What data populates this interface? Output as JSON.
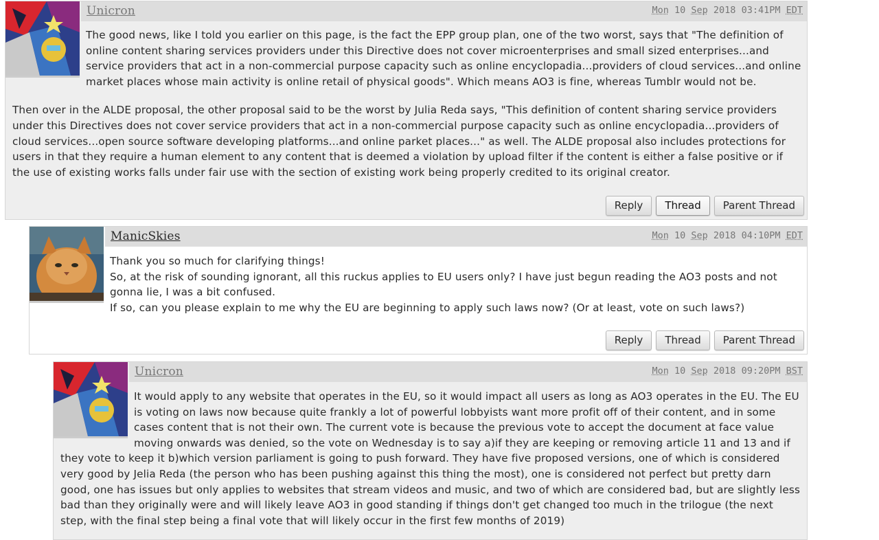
{
  "comments": [
    {
      "author": "Unicron",
      "date": {
        "dow": "Mon",
        "day": "10",
        "month": "Sep",
        "year": "2018",
        "time": "03:41PM",
        "tz": "EDT"
      },
      "paragraphs": [
        "The good news, like I told you earlier on this page, is the fact the EPP group plan, one of the two worst, says that \"The definition of online content sharing services providers under this Directive does not cover microenterprises and small sized enterprises...and service providers that act in a non-commercial purpose capacity such as online encyclopadia...providers of cloud services...and online market places whose main activity is online retail of physical goods\". Which means AO3 is fine, whereas Tumblr would not be.",
        "Then over in the ALDE proposal, the other proposal said to be the worst by Julia Reda says, \"This definition of content sharing service providers under this Directives does not cover service providers that act in a non-commercial purpose capacity such as online encyclopadia...providers of cloud services...open source software developing platforms...and online parket places...\" as well. The ALDE proposal also includes protections for users in that they require a human element to any content that is deemed a violation by upload filter if the content is either a false positive or if the use of existing works falls under fair use with the section of existing work being properly credited to its original creator."
      ],
      "buttons": [
        "Reply",
        "Thread",
        "Parent Thread"
      ]
    },
    {
      "author": "ManicSkies",
      "date": {
        "dow": "Mon",
        "day": "10",
        "month": "Sep",
        "year": "2018",
        "time": "04:10PM",
        "tz": "EDT"
      },
      "lines": [
        "Thank you so much for clarifying things!",
        "So, at the risk of sounding ignorant, all this ruckus applies to EU users only? I have just begun reading the AO3 posts and not gonna lie, I was a bit confused.",
        "If so, can you please explain to me why the EU are beginning to apply such laws now? (Or at least, vote on such laws?)"
      ],
      "buttons": [
        "Reply",
        "Thread",
        "Parent Thread"
      ]
    },
    {
      "author": "Unicron",
      "date": {
        "dow": "Mon",
        "day": "10",
        "month": "Sep",
        "year": "2018",
        "time": "09:20PM",
        "tz": "BST"
      },
      "paragraphs": [
        "It would apply to any website that operates in the EU, so it would impact all users as long as AO3 operates in the EU. The EU is voting on laws now because quite frankly a lot of powerful lobbyists want more profit off of their content, and in some cases content that is not their own. The current vote is because the previous vote to accept the document at face value moving onwards was denied, so the vote on Wednesday is to say a)if they are keeping or removing article 11 and 13 and if they vote to keep it b)which version parliament is going to push forward. They have five proposed versions, one of which is considered very good by Jelia Reda (the person who has been pushing against this thing the most), one is considered not perfect but pretty darn good, one has issues but only applies to websites that stream videos and music, and two of which are considered bad, but are slightly less bad than they originally were and will likely leave AO3 in good standing if things don't get changed too much in the trilogue (the next step, with the final step being a final vote that will likely occur in the first few months of 2019)"
      ]
    }
  ]
}
